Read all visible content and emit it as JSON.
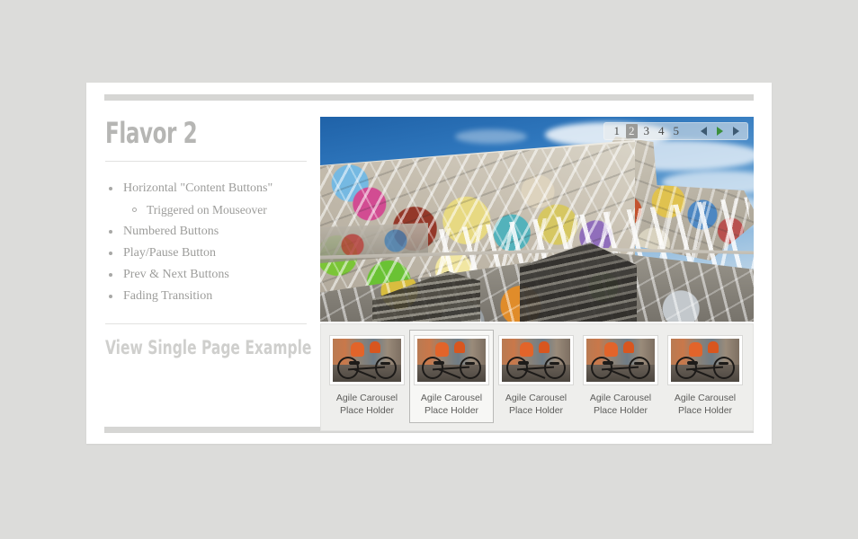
{
  "page": {
    "background_color": "#dcdcda",
    "container_color": "#ffffff"
  },
  "left_panel": {
    "title": "Flavor 2",
    "features": [
      {
        "label": "Horizontal \"Content Buttons\"",
        "level": 0
      },
      {
        "label": "Triggered on Mouseover",
        "level": 1
      },
      {
        "label": "Numbered Buttons",
        "level": 0
      },
      {
        "label": "Play/Pause Button",
        "level": 0
      },
      {
        "label": "Prev & Next Buttons",
        "level": 0
      },
      {
        "label": "Fading Transition",
        "level": 0
      }
    ],
    "single_page_link": "View Single Page Example"
  },
  "carousel": {
    "active_slide": 2,
    "nav": {
      "numbers": [
        "1",
        "2",
        "3",
        "4",
        "5"
      ],
      "prev_icon": "prev-triangle-icon",
      "play_icon": "play-triangle-icon",
      "next_icon": "next-triangle-icon",
      "active_number_bg": "#9a9a98",
      "play_color": "#3b8f3b",
      "arrow_color": "#3d5a72"
    },
    "slide_alt": "Graffiti covered skate park wall with stairs under blue sky"
  },
  "thumbnails": [
    {
      "line1": "Agile Carousel",
      "line2": "Place Holder",
      "selected": false
    },
    {
      "line1": "Agile Carousel",
      "line2": "Place Holder",
      "selected": true
    },
    {
      "line1": "Agile Carousel",
      "line2": "Place Holder",
      "selected": false
    },
    {
      "line1": "Agile Carousel",
      "line2": "Place Holder",
      "selected": false
    },
    {
      "line1": "Agile Carousel",
      "line2": "Place Holder",
      "selected": false
    }
  ]
}
